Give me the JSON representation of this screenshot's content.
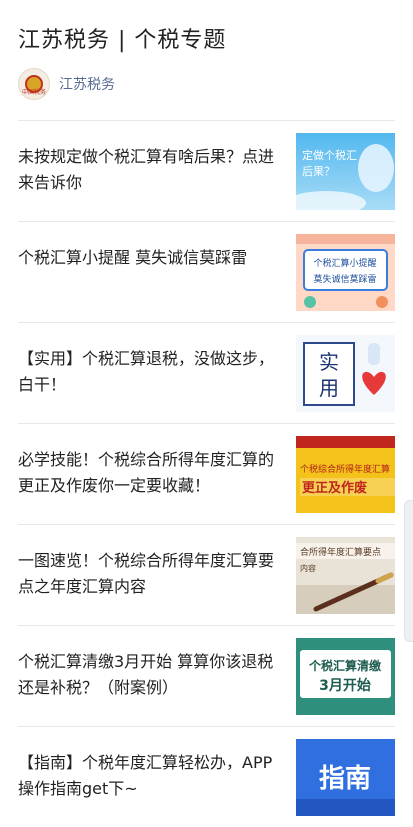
{
  "header": {
    "title": "江苏税务 | 个税专题"
  },
  "account": {
    "name": "江苏税务",
    "avatar_text": "中国税务"
  },
  "articles": [
    {
      "title": "未按规定做个税汇算有啥后果？点进来告诉你",
      "thumb_text": [
        "定做个税汇",
        "后果？"
      ]
    },
    {
      "title": "个税汇算小提醒 莫失诚信莫踩雷",
      "thumb_text": [
        "个税汇算小提醒",
        "莫失诚信莫踩雷"
      ]
    },
    {
      "title": "【实用】个税汇算退税，没做这步，白干！",
      "thumb_text": [
        "实",
        "用"
      ]
    },
    {
      "title": "必学技能！个税综合所得年度汇算的更正及作废你一定要收藏！",
      "thumb_text": [
        "个税综合所得年度汇算",
        "更正及作废"
      ]
    },
    {
      "title": "一图速览！个税综合所得年度汇算要点之年度汇算内容",
      "thumb_text": [
        "合所得年度汇算要点",
        "内容"
      ]
    },
    {
      "title": "个税汇算清缴3月开始 算算你该退税还是补税？（附案例）",
      "thumb_text": [
        "个税汇算清缴",
        "3月开始"
      ]
    },
    {
      "title": "【指南】个税年度汇算轻松办，APP操作指南get下~",
      "thumb_text": [
        "指南"
      ]
    }
  ]
}
